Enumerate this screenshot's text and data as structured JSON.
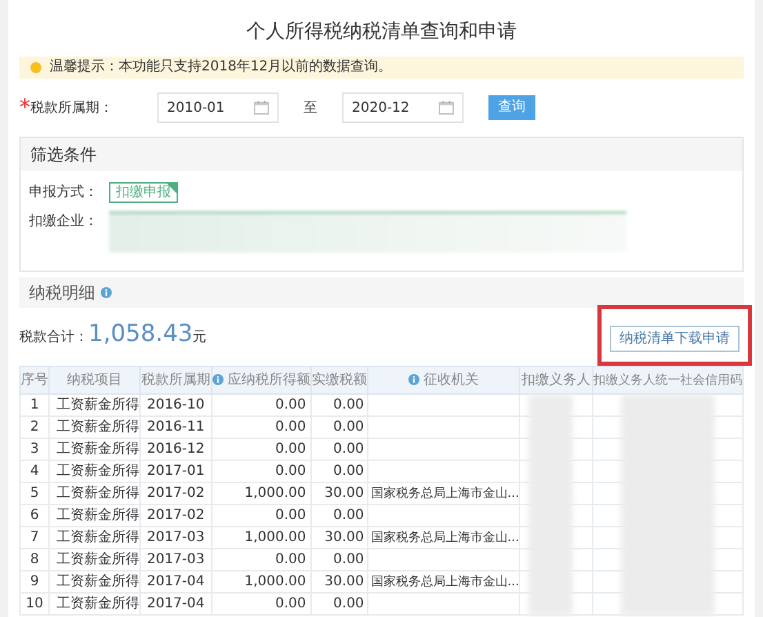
{
  "title": "个人所得税纳税清单查询和申请",
  "notice": "温馨提示：本功能只支持2018年12月以前的数据查询。",
  "period": {
    "label": "税款所属期：",
    "required_mark": "*",
    "start": "2010-01",
    "separator": "至",
    "end": "2020-12",
    "button": "查询"
  },
  "filter": {
    "heading": "筛选条件",
    "method_label": "申报方式：",
    "methods": [
      {
        "label": "扣缴申报",
        "selected": true
      }
    ],
    "company_label": "扣缴企业："
  },
  "detail": {
    "heading": "纳税明细",
    "total_label": "税款合计：",
    "total": "1,058.43",
    "unit": "元",
    "button": "纳税清单下载申请"
  },
  "table": {
    "columns": [
      {
        "label": "序号",
        "info": false
      },
      {
        "label": "纳税项目",
        "info": false
      },
      {
        "label": "税款所属期",
        "info": false
      },
      {
        "label": "应纳税所得额",
        "info": true
      },
      {
        "label": "实缴税额",
        "info": false
      },
      {
        "label": "征收机关",
        "info": true
      },
      {
        "label": "扣缴义务人",
        "info": false
      },
      {
        "label": "扣缴义务人统一社会信用码",
        "info": false
      }
    ],
    "rows": [
      [
        "1",
        "工资薪金所得",
        "2016-10",
        "0.00",
        "0.00",
        ""
      ],
      [
        "2",
        "工资薪金所得",
        "2016-11",
        "0.00",
        "0.00",
        ""
      ],
      [
        "3",
        "工资薪金所得",
        "2016-12",
        "0.00",
        "0.00",
        ""
      ],
      [
        "4",
        "工资薪金所得",
        "2017-01",
        "0.00",
        "0.00",
        ""
      ],
      [
        "5",
        "工资薪金所得",
        "2017-02",
        "1,000.00",
        "30.00",
        "国家税务总局上海市金山..."
      ],
      [
        "6",
        "工资薪金所得",
        "2017-02",
        "0.00",
        "0.00",
        ""
      ],
      [
        "7",
        "工资薪金所得",
        "2017-03",
        "1,000.00",
        "30.00",
        "国家税务总局上海市金山..."
      ],
      [
        "8",
        "工资薪金所得",
        "2017-03",
        "0.00",
        "0.00",
        ""
      ],
      [
        "9",
        "工资薪金所得",
        "2017-04",
        "1,000.00",
        "30.00",
        "国家税务总局上海市金山..."
      ],
      [
        "10",
        "工资薪金所得",
        "2017-04",
        "0.00",
        "0.00",
        ""
      ]
    ]
  }
}
